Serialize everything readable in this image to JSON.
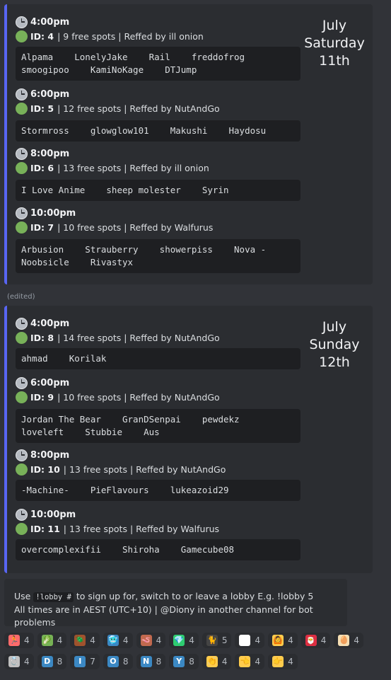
{
  "embeds": [
    {
      "date": {
        "month": "July",
        "weekday": "Saturday",
        "day": "11th"
      },
      "slots": [
        {
          "time": "4:00pm",
          "id_label": "ID: 4",
          "info": "| 9 free spots | Reffed by ill onion",
          "players": "Alpama    LonelyJake    Rail    freddofrog\nsmoogipoo    KamiNoKage    DTJump"
        },
        {
          "time": "6:00pm",
          "id_label": "ID: 5",
          "info": "| 12 free spots | Reffed by NutAndGo",
          "players": "Stormross    glowglow101    Makushi    Haydosu"
        },
        {
          "time": "8:00pm",
          "id_label": "ID: 6",
          "info": "| 13 free spots | Reffed by ill onion",
          "players": "I Love Anime    sheep molester    Syrin"
        },
        {
          "time": "10:00pm",
          "id_label": "ID: 7",
          "info": "| 10 free spots | Reffed by Walfurus",
          "players": "Arbusion    Strauberry    showerpiss    Nova -\nNoobsicle    Rivastyx"
        }
      ]
    },
    {
      "date": {
        "month": "July",
        "weekday": "Sunday",
        "day": "12th"
      },
      "slots": [
        {
          "time": "4:00pm",
          "id_label": "ID: 8",
          "info": "| 14 free spots | Reffed by NutAndGo",
          "players": "ahmad    Korilak"
        },
        {
          "time": "6:00pm",
          "id_label": "ID: 9",
          "info": "| 10 free spots | Reffed by NutAndGo",
          "players": "Jordan The Bear    GranDSenpai    pewdekz\nloveleft    Stubbie    Aus"
        },
        {
          "time": "8:00pm",
          "id_label": "ID: 10",
          "info": "| 13 free spots | Reffed by NutAndGo",
          "players": "-Machine-    PieFlavours    lukeazoid29"
        },
        {
          "time": "10:00pm",
          "id_label": "ID: 11",
          "info": "| 13 free spots | Reffed by Walfurus",
          "players": "overcomplexifii    Shiroha    Gamecube08"
        }
      ]
    }
  ],
  "edited_label": "(edited)",
  "footer": {
    "use_prefix": "Use ",
    "command": "!lobby #",
    "use_suffix": " to sign up for, switch to or leave a lobby E.g. !lobby 5",
    "line2": "All times are in AEST (UTC+10) | @Diony in another channel for bot problems"
  },
  "reactions_row1": [
    {
      "icon": "person-running-icon",
      "glyph": "🏃",
      "color": "#ff6b6b",
      "count": "4"
    },
    {
      "icon": "leafy-green-icon",
      "glyph": "🥬",
      "color": "#77b255",
      "count": "4"
    },
    {
      "icon": "beetle-icon",
      "glyph": "🪲",
      "color": "#a0522d",
      "count": "4"
    },
    {
      "icon": "blue-face-icon",
      "glyph": "🥶",
      "color": "#3b88c3",
      "count": "4"
    },
    {
      "icon": "worm-icon",
      "glyph": "🪱",
      "color": "#c1694f",
      "count": "4"
    },
    {
      "icon": "gem-icon",
      "glyph": "💎",
      "color": "#2ecc71",
      "count": "4"
    },
    {
      "icon": "black-cat-icon",
      "glyph": "🐈",
      "color": "#444444",
      "count": "5"
    },
    {
      "icon": "cat-face-icon",
      "glyph": "🐱",
      "color": "#ffffff",
      "count": "4"
    },
    {
      "icon": "person-gesturing-icon",
      "glyph": "🙆",
      "color": "#ffcc4d",
      "count": "4"
    },
    {
      "icon": "santa-icon",
      "glyph": "🎅",
      "color": "#dd2e44",
      "count": "4"
    },
    {
      "icon": "egg-icon",
      "glyph": "🥚",
      "color": "#f5deb3",
      "count": "4"
    }
  ],
  "reactions_row2": [
    {
      "icon": "ring-icon",
      "glyph": "💍",
      "color": "#c0c0c0",
      "count": "4"
    },
    {
      "icon": "letter-d-icon",
      "glyph": "D",
      "color": "#3b88c3",
      "count": "8"
    },
    {
      "icon": "letter-i-icon",
      "glyph": "I",
      "color": "#3b88c3",
      "count": "7"
    },
    {
      "icon": "letter-o-icon",
      "glyph": "O",
      "color": "#3b88c3",
      "count": "8"
    },
    {
      "icon": "letter-n-icon",
      "glyph": "N",
      "color": "#3b88c3",
      "count": "8"
    },
    {
      "icon": "letter-y-icon",
      "glyph": "Y",
      "color": "#3b88c3",
      "count": "8"
    },
    {
      "icon": "clapping-hands-icon",
      "glyph": "👏",
      "color": "#ffcc4d",
      "count": "4"
    },
    {
      "icon": "pointing-left-icon",
      "glyph": "👈",
      "color": "#ffcc4d",
      "count": "4"
    },
    {
      "icon": "pointing-right-icon",
      "glyph": "👉",
      "color": "#ffcc4d",
      "count": "4"
    }
  ]
}
